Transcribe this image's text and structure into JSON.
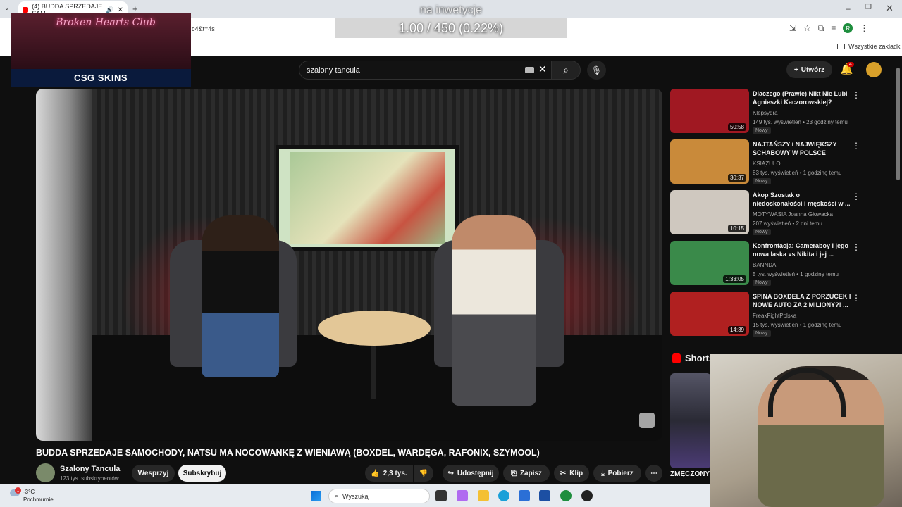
{
  "browser": {
    "tab_title": "(4) BUDDA SPRZEDAJE SAM",
    "url_fragment": "c4&t=4s",
    "bookmarks_all": "Wszystkie zakładki",
    "profile_letter": "R"
  },
  "stream_overlay": {
    "label": "na inwetycje",
    "progress": "1.00 / 450 (0.22%)",
    "promo_title": "Broken Hearts Club",
    "promo_brand": "CSG SKINS"
  },
  "youtube": {
    "search_query": "szalony tancula",
    "create_label": "Utwórz",
    "notification_count": "4"
  },
  "video": {
    "title": "BUDDA SPRZEDAJE SAMOCHODY, NATSU MA NOCOWANKĘ Z WIENIAWĄ (BOXDEL, WARDĘGA, RAFONIX, SZYMOOL)",
    "channel": "Szalony Tancula",
    "subscribers": "123 tys. subskrybentów",
    "support_label": "Wesprzyj",
    "subscribe_label": "Subskrybuj",
    "likes": "2,3 tys.",
    "share_label": "Udostępnij",
    "save_label": "Zapisz",
    "clip_label": "Klip",
    "download_label": "Pobierz"
  },
  "recommendations": [
    {
      "title": "Dlaczego (Prawie) Nikt Nie Lubi Agnieszki Kaczorowskiej?",
      "channel": "Klepsydra",
      "meta": "149 tys. wyświetleń • 23 godziny temu",
      "badge": "Nowy",
      "duration": "50:58",
      "thumb_color": "#a01822"
    },
    {
      "title": "NAJTAŃSZY i NAJWIĘKSZY SCHABOWY W POLSCE",
      "channel": "KSIĄŻULO",
      "meta": "83 tys. wyświetleń • 1 godzinę temu",
      "badge": "Nowy",
      "duration": "30:37",
      "thumb_color": "#c98a3a"
    },
    {
      "title": "Akop Szostak o niedoskonałości i męskości w ...",
      "channel": "MOTYWASIA Joanna Głowacka",
      "meta": "207 wyświetleń • 2 dni temu",
      "badge": "Nowy",
      "duration": "10:15",
      "thumb_color": "#cfc8bf"
    },
    {
      "title": "Konfrontacja: Cameraboy i jego nowa laska vs Nikita i jej ...",
      "channel": "BANNDA",
      "meta": "5 tys. wyświetleń • 1 godzinę temu",
      "badge": "Nowy",
      "duration": "1:33:05",
      "thumb_color": "#3a8a4a"
    },
    {
      "title": "SPINA BOXDELA Z PORZUCEK I NOWE AUTO ZA 2 MILIONY?! ...",
      "channel": "FreakFightPolska",
      "meta": "15 tys. wyświetleń • 1 godzinę temu",
      "badge": "Nowy",
      "duration": "14:39",
      "thumb_color": "#b02020"
    }
  ],
  "shorts": {
    "label": "Shorts",
    "caption": "ZMĘCZONY"
  },
  "taskbar": {
    "temperature": "-3°C",
    "weather": "Pochmurnie",
    "weather_badge": "1",
    "search_placeholder": "Wyszukaj"
  }
}
